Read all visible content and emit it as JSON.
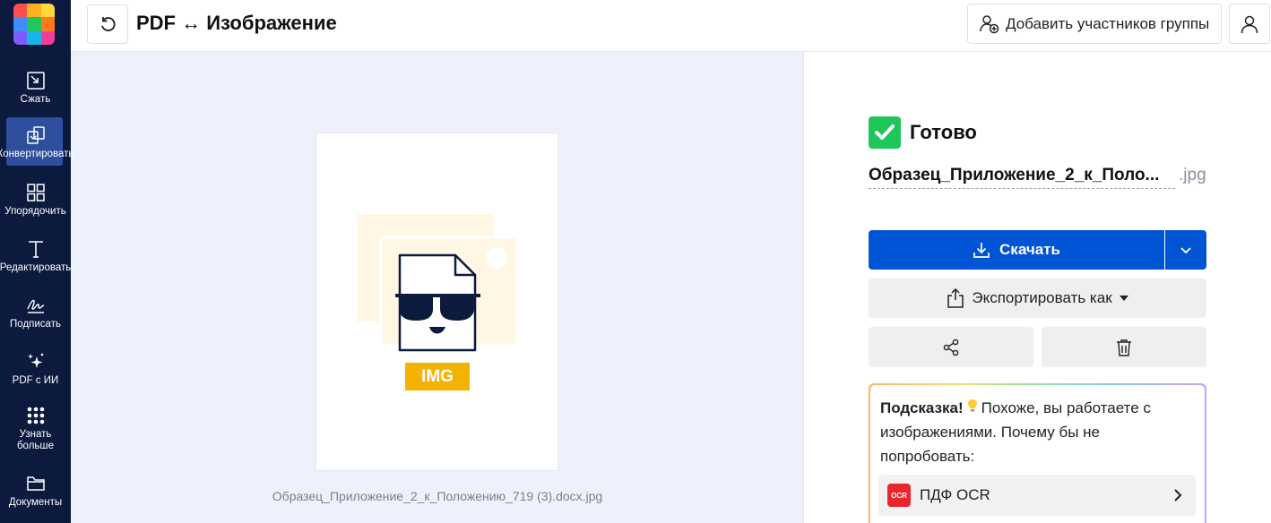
{
  "app": {
    "page_title": "PDF ↔ Изображение",
    "logo_colors": [
      "#ff4f4f",
      "#ffb21e",
      "#ffd83b",
      "#3f8cff",
      "#22c55e",
      "#ff7a1e",
      "#7c5cff",
      "#18b5e8",
      "#ef3f9a"
    ]
  },
  "sidebar": {
    "items": [
      {
        "label": "Сжать",
        "icon": "compress-icon"
      },
      {
        "label": "Конвертировать",
        "icon": "convert-icon",
        "active": true
      },
      {
        "label": "Упорядочить",
        "icon": "organize-icon"
      },
      {
        "label": "Редактировать",
        "icon": "edit-text-icon"
      },
      {
        "label": "Подписать",
        "icon": "sign-icon"
      },
      {
        "label": "PDF с ИИ",
        "icon": "ai-sparkle-icon"
      },
      {
        "label": "Узнать больше",
        "icon": "apps-grid-icon"
      },
      {
        "label": "Документы",
        "icon": "folder-icon"
      }
    ]
  },
  "topbar": {
    "add_members_label": "Добавить участников группы"
  },
  "preview": {
    "badge_text": "IMG",
    "file_caption": "Образец_Приложение_2_к_Положению_719 (3).docx.jpg"
  },
  "result": {
    "status": "Готово",
    "filename": "Образец_Приложение_2_к_Поло...",
    "extension": ".jpg",
    "download_label": "Скачать",
    "export_label": "Экспортировать как"
  },
  "hint": {
    "title": "Подсказка!",
    "text": "Похоже, вы работаете с изображениями. Почему бы не попробовать:",
    "ocr_badge": "OCR",
    "ocr_label": "ПДФ OCR"
  },
  "colors": {
    "sidebar_bg": "#0b1a3d",
    "primary": "#0055d4",
    "success": "#1fc65a",
    "img_badge": "#f5b301"
  }
}
